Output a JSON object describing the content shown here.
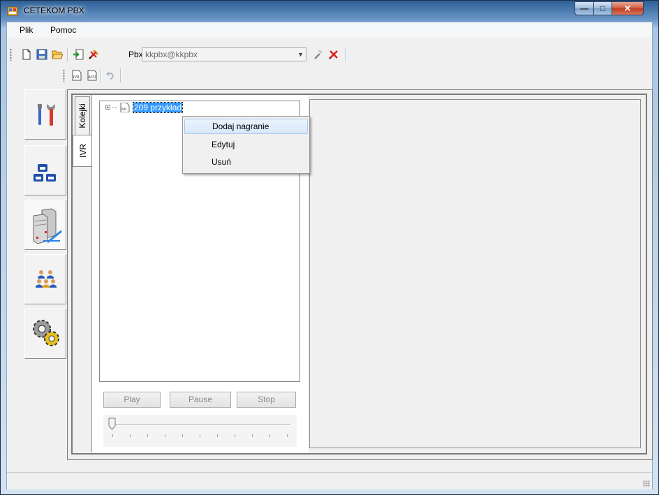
{
  "window": {
    "title": "CETEKOM PBX",
    "controls": {
      "minimize": "—",
      "maximize": "□",
      "close": "✕"
    }
  },
  "menu": {
    "items": [
      "Plik",
      "Pomoc"
    ]
  },
  "toolbar": {
    "pbx_label": "Pbx:",
    "pbx_value": "kkpbx@kkpbx",
    "icons": [
      "new-file-icon",
      "save-icon",
      "open-folder-icon",
      "import-icon",
      "disconnect-icon",
      "connect-icon",
      "disconnect-cross-icon"
    ]
  },
  "toolbar2": {
    "icons": [
      "ivr-icon",
      "acd-icon",
      "undo-icon"
    ]
  },
  "sidebar": {
    "items": [
      "tools-icon",
      "phones-icon",
      "servers-icon",
      "users-icon",
      "settings-gears-icon"
    ],
    "active_index": 2
  },
  "tabs": {
    "items": [
      "Kolejki",
      "IVR"
    ],
    "selected": "IVR"
  },
  "tree": {
    "node_label": "209 przykład",
    "node_icon_text": "IVR"
  },
  "context_menu": {
    "items": [
      "Dodaj nagranie",
      "Edytuj",
      "Usuń"
    ],
    "highlighted": "Dodaj nagranie"
  },
  "player": {
    "play_label": "Play",
    "pause_label": "Pause",
    "stop_label": "Stop",
    "position_fraction": 0
  }
}
